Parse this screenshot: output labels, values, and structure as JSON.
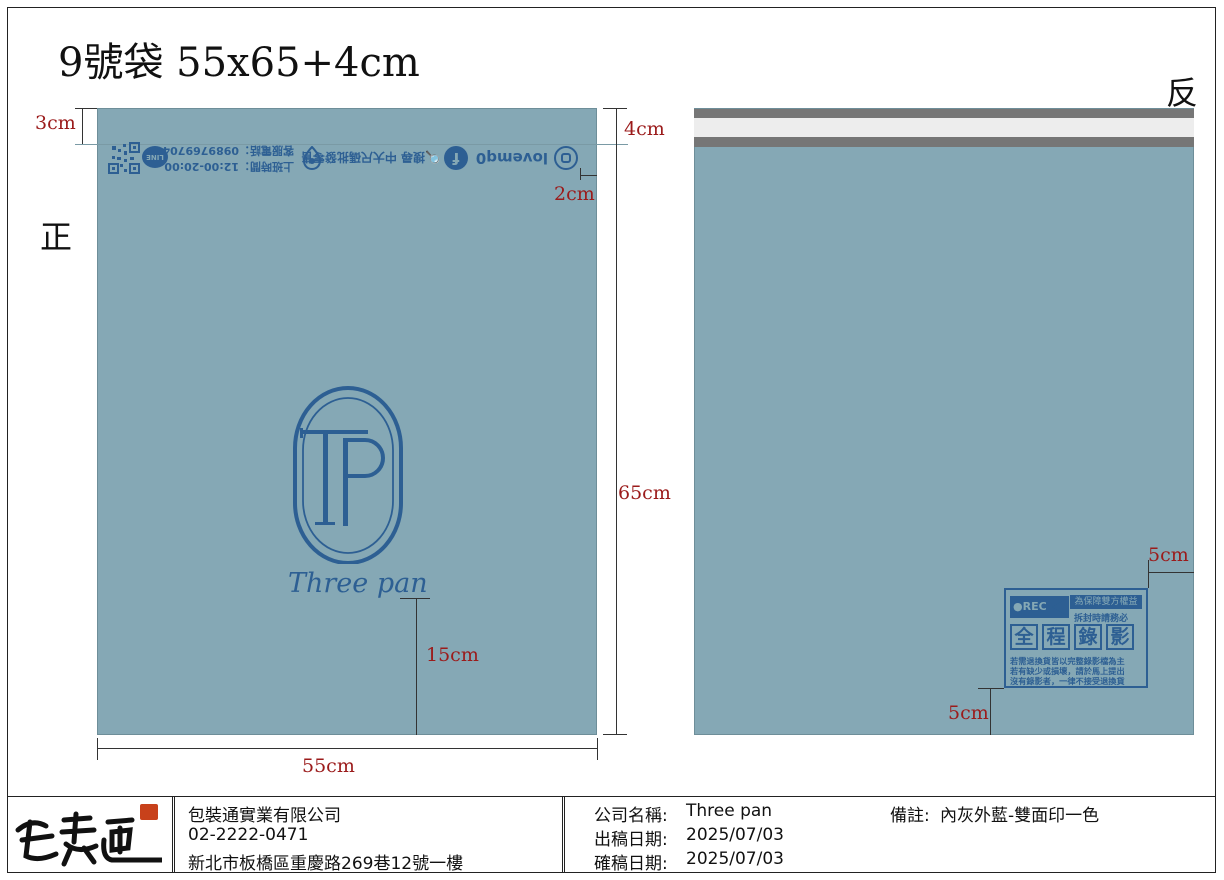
{
  "title": "9號袋 55x65+4cm",
  "front_label": "正",
  "back_label": "反",
  "dims": {
    "top_flap": "3cm",
    "seal": "4cm",
    "right_margin_front": "2cm",
    "height": "65cm",
    "logo_to_bottom": "15cm",
    "width": "55cm",
    "back_right": "5cm",
    "back_bottom": "5cm"
  },
  "front_print": {
    "instagram": "lovemq0",
    "facebook": "🔍搜尋 中大尺碼批發零售",
    "hours": "上班時間：12:00-20:00",
    "phone": "客服電話：0989769704",
    "line": "LINE"
  },
  "logo": {
    "mark": "TP",
    "name": "Three pan"
  },
  "rec_label": {
    "rec": "●REC",
    "guard": "為保障雙方權益",
    "note": "拆封時請務必",
    "headline": [
      "全",
      "程",
      "錄",
      "影"
    ],
    "body": [
      "若需退換貨皆以完整錄影檔為主",
      "若有缺少或損壞，請於馬上提出",
      "沒有錄影者，一律不接受退換貨"
    ]
  },
  "footer": {
    "company": "包裝通實業有限公司",
    "phone": "02-2222-0471",
    "address": "新北市板橋區重慶路269巷12號一樓",
    "client_label": "公司名稱:",
    "client_value": "Three pan",
    "draft_label": "出稿日期:",
    "draft_date": "2025/07/03",
    "confirm_label": "確稿日期:",
    "confirm_date": "2025/07/03",
    "note_label": "備註:",
    "note_value": "內灰外藍-雙面印一色"
  },
  "colors": {
    "bag": "#85a8b5",
    "print": "#2d5f93",
    "dimension": "#9b1b1b",
    "seal_dark": "#767676",
    "seal_light": "#ededed"
  }
}
